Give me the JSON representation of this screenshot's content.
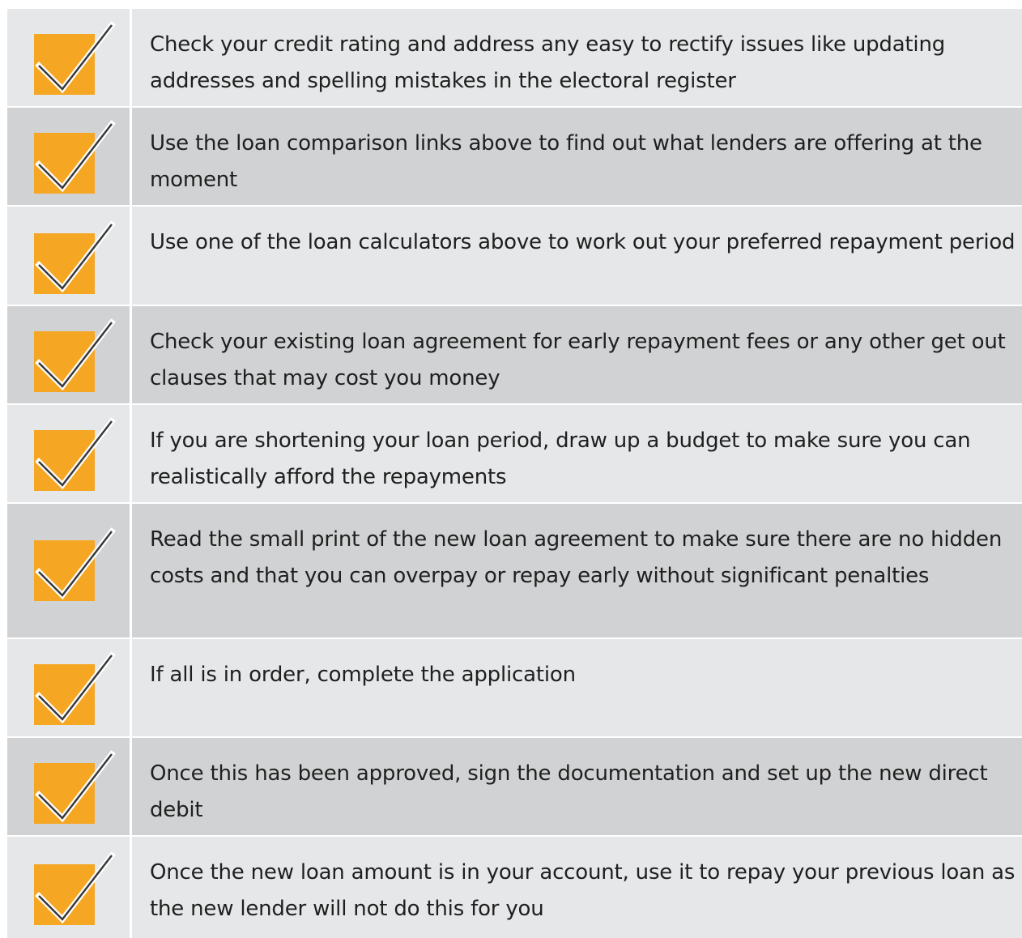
{
  "colors": {
    "accent": "#f5a623",
    "row_light": "#e6e7e8",
    "row_dark": "#d1d2d3",
    "divider": "#ffffff"
  },
  "checklist": {
    "items": [
      {
        "icon": "checkmark-icon",
        "text": "Check your credit rating and address any easy to rectify issues like updating addresses and spelling mistakes in the electoral register"
      },
      {
        "icon": "checkmark-icon",
        "text": "Use the loan comparison links above to find out what lenders are offering at the moment"
      },
      {
        "icon": "checkmark-icon",
        "text": "Use one of the loan calculators above to work out your preferred repayment period"
      },
      {
        "icon": "checkmark-icon",
        "text": "Check your existing loan agreement for early repayment fees or any other get out clauses that may cost you money"
      },
      {
        "icon": "checkmark-icon",
        "text": "If you are shortening your loan period, draw up a budget to make sure you can realistically afford the repayments"
      },
      {
        "icon": "checkmark-icon",
        "text": "Read the small print of the new loan agreement to make sure there are no hidden costs and that you can overpay or repay early without significant penalties"
      },
      {
        "icon": "checkmark-icon",
        "text": "If all is in order, complete the application"
      },
      {
        "icon": "checkmark-icon",
        "text": "Once this has been approved, sign the documentation and set up the new direct debit"
      },
      {
        "icon": "checkmark-icon",
        "text": "Once the new loan amount is in your account, use it to repay your previous loan as the new lender will not do this for you"
      }
    ]
  }
}
